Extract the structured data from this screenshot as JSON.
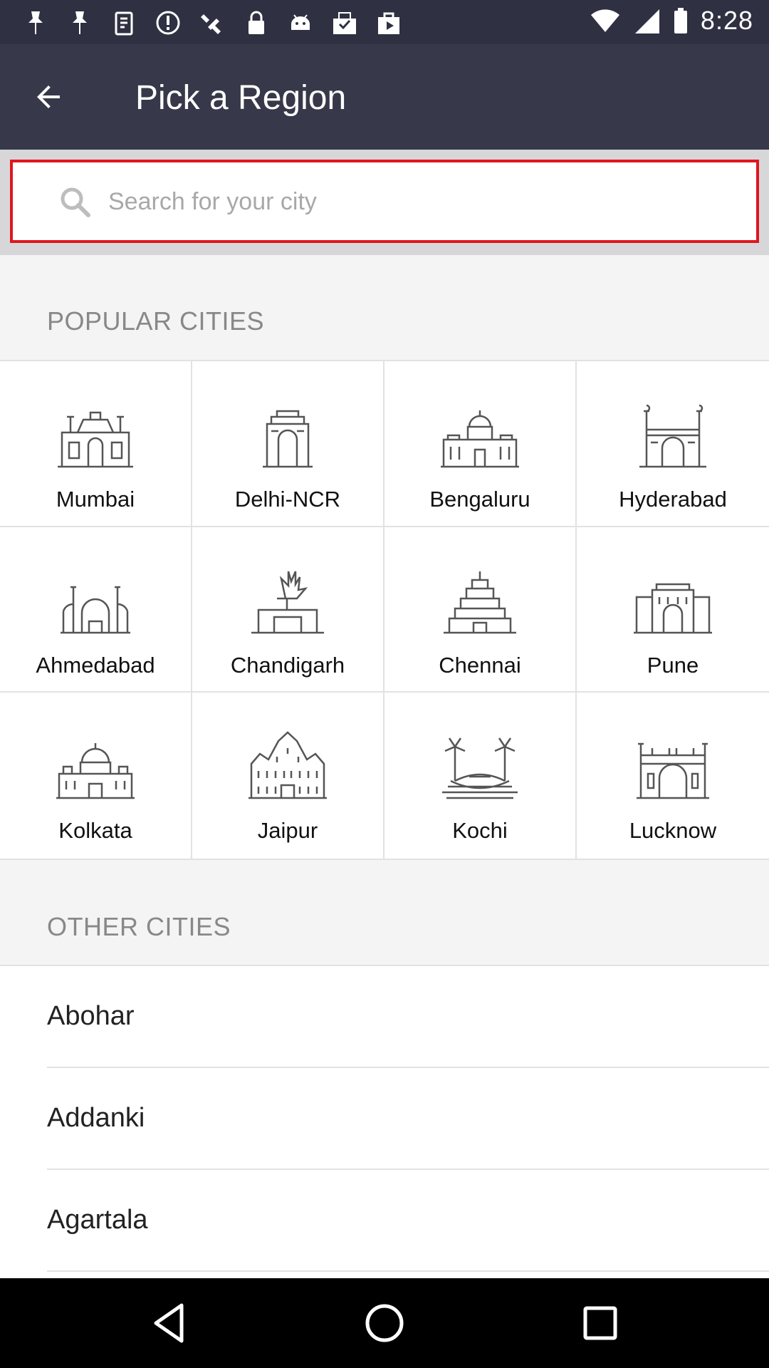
{
  "status_bar": {
    "time": "8:28",
    "left_icons": [
      "pin-icon",
      "pin-icon",
      "clipboard-icon",
      "alert-icon",
      "satellite-icon",
      "lock-icon",
      "android-icon",
      "check-mail-icon",
      "play-bag-icon"
    ]
  },
  "header": {
    "title": "Pick a Region",
    "back_icon": "arrow-left-icon",
    "background": "#373849"
  },
  "search": {
    "placeholder": "Search for your city",
    "value": "",
    "border_color": "#e0161e"
  },
  "popular": {
    "title": "POPULAR CITIES",
    "cities": [
      {
        "name": "Mumbai",
        "icon": "gateway-monument-icon"
      },
      {
        "name": "Delhi-NCR",
        "icon": "india-gate-icon"
      },
      {
        "name": "Bengaluru",
        "icon": "vidhana-soudha-icon"
      },
      {
        "name": "Hyderabad",
        "icon": "charminar-icon"
      },
      {
        "name": "Ahmedabad",
        "icon": "mosque-icon"
      },
      {
        "name": "Chandigarh",
        "icon": "open-hand-monument-icon"
      },
      {
        "name": "Chennai",
        "icon": "temple-icon"
      },
      {
        "name": "Pune",
        "icon": "shaniwar-wada-icon"
      },
      {
        "name": "Kolkata",
        "icon": "victoria-memorial-icon"
      },
      {
        "name": "Jaipur",
        "icon": "hawa-mahal-icon"
      },
      {
        "name": "Kochi",
        "icon": "palm-boat-icon"
      },
      {
        "name": "Lucknow",
        "icon": "rumi-darwaza-icon"
      }
    ]
  },
  "other": {
    "title": "OTHER CITIES",
    "cities": [
      "Abohar",
      "Addanki",
      "Agartala"
    ]
  },
  "nav": {
    "back": "back-triangle-icon",
    "home": "home-circle-icon",
    "recents": "recents-square-icon"
  }
}
